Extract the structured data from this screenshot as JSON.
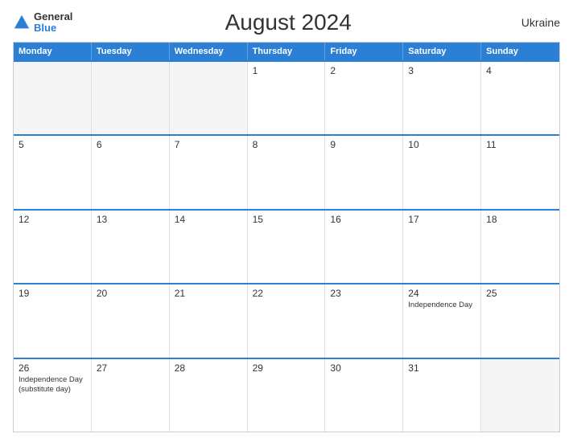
{
  "logo": {
    "general": "General",
    "blue": "Blue"
  },
  "title": "August 2024",
  "country": "Ukraine",
  "header_days": [
    "Monday",
    "Tuesday",
    "Wednesday",
    "Thursday",
    "Friday",
    "Saturday",
    "Sunday"
  ],
  "weeks": [
    [
      {
        "day": "",
        "empty": true
      },
      {
        "day": "",
        "empty": true
      },
      {
        "day": "",
        "empty": true
      },
      {
        "day": "1",
        "empty": false,
        "event": ""
      },
      {
        "day": "2",
        "empty": false,
        "event": ""
      },
      {
        "day": "3",
        "empty": false,
        "event": ""
      },
      {
        "day": "4",
        "empty": false,
        "event": ""
      }
    ],
    [
      {
        "day": "5",
        "empty": false,
        "event": ""
      },
      {
        "day": "6",
        "empty": false,
        "event": ""
      },
      {
        "day": "7",
        "empty": false,
        "event": ""
      },
      {
        "day": "8",
        "empty": false,
        "event": ""
      },
      {
        "day": "9",
        "empty": false,
        "event": ""
      },
      {
        "day": "10",
        "empty": false,
        "event": ""
      },
      {
        "day": "11",
        "empty": false,
        "event": ""
      }
    ],
    [
      {
        "day": "12",
        "empty": false,
        "event": ""
      },
      {
        "day": "13",
        "empty": false,
        "event": ""
      },
      {
        "day": "14",
        "empty": false,
        "event": ""
      },
      {
        "day": "15",
        "empty": false,
        "event": ""
      },
      {
        "day": "16",
        "empty": false,
        "event": ""
      },
      {
        "day": "17",
        "empty": false,
        "event": ""
      },
      {
        "day": "18",
        "empty": false,
        "event": ""
      }
    ],
    [
      {
        "day": "19",
        "empty": false,
        "event": ""
      },
      {
        "day": "20",
        "empty": false,
        "event": ""
      },
      {
        "day": "21",
        "empty": false,
        "event": ""
      },
      {
        "day": "22",
        "empty": false,
        "event": ""
      },
      {
        "day": "23",
        "empty": false,
        "event": ""
      },
      {
        "day": "24",
        "empty": false,
        "event": "Independence Day"
      },
      {
        "day": "25",
        "empty": false,
        "event": ""
      }
    ],
    [
      {
        "day": "26",
        "empty": false,
        "event": "Independence Day (substitute day)"
      },
      {
        "day": "27",
        "empty": false,
        "event": ""
      },
      {
        "day": "28",
        "empty": false,
        "event": ""
      },
      {
        "day": "29",
        "empty": false,
        "event": ""
      },
      {
        "day": "30",
        "empty": false,
        "event": ""
      },
      {
        "day": "31",
        "empty": false,
        "event": ""
      },
      {
        "day": "",
        "empty": true,
        "event": ""
      }
    ]
  ]
}
